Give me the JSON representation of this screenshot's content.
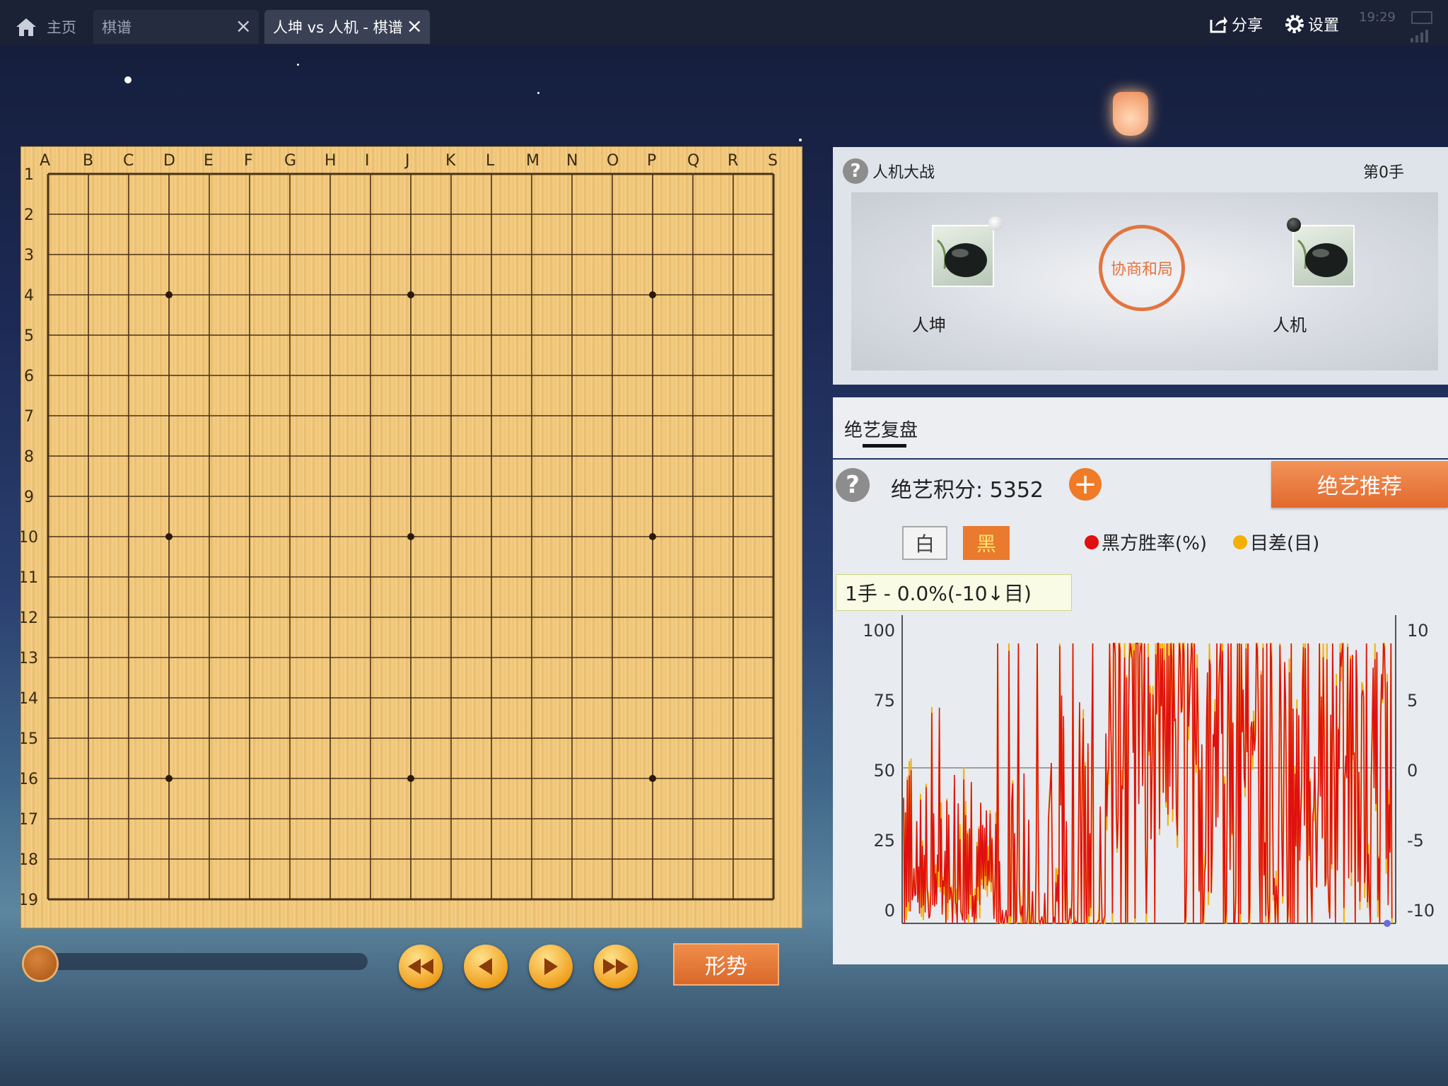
{
  "tabs": [
    {
      "label": "主页"
    },
    {
      "label": "棋谱"
    },
    {
      "label": "人坤 vs 人机 - 棋谱"
    }
  ],
  "toolbar": {
    "share_label": "分享",
    "settings_label": "设置",
    "clock": "19:29"
  },
  "board": {
    "columns": [
      "A",
      "B",
      "C",
      "D",
      "E",
      "F",
      "G",
      "H",
      "I",
      "J",
      "K",
      "L",
      "M",
      "N",
      "O",
      "P",
      "Q",
      "R",
      "S"
    ],
    "rows": [
      "1",
      "2",
      "3",
      "4",
      "5",
      "6",
      "7",
      "8",
      "9",
      "10",
      "11",
      "12",
      "13",
      "14",
      "15",
      "16",
      "17",
      "18",
      "19"
    ],
    "size": 19
  },
  "controls": {
    "situation_label": "形势"
  },
  "match": {
    "title": "人机大战",
    "move_label": "第0手",
    "left_player": "人坤",
    "right_player": "人机",
    "stamp_text": "协商和局"
  },
  "review": {
    "tab_label": "绝艺复盘",
    "score_label": "绝艺积分: 5352",
    "recommend_label": "绝艺推荐",
    "white_label": "白",
    "black_label": "黑",
    "legend_winrate": "黑方胜率(%)",
    "legend_diff": "目差(目)",
    "tooltip": "1手 - 0.0%(-10↓目)"
  },
  "chart_data": {
    "type": "line",
    "yleft": {
      "ticks": [
        "100",
        "75",
        "50",
        "25",
        "0"
      ],
      "range": [
        0,
        100
      ]
    },
    "yright": {
      "ticks": [
        "10",
        "5",
        "0",
        "-5",
        "-10"
      ],
      "range": [
        -10,
        10
      ]
    },
    "colors": {
      "winrate": "#e01010",
      "diff": "#f4b000"
    }
  }
}
